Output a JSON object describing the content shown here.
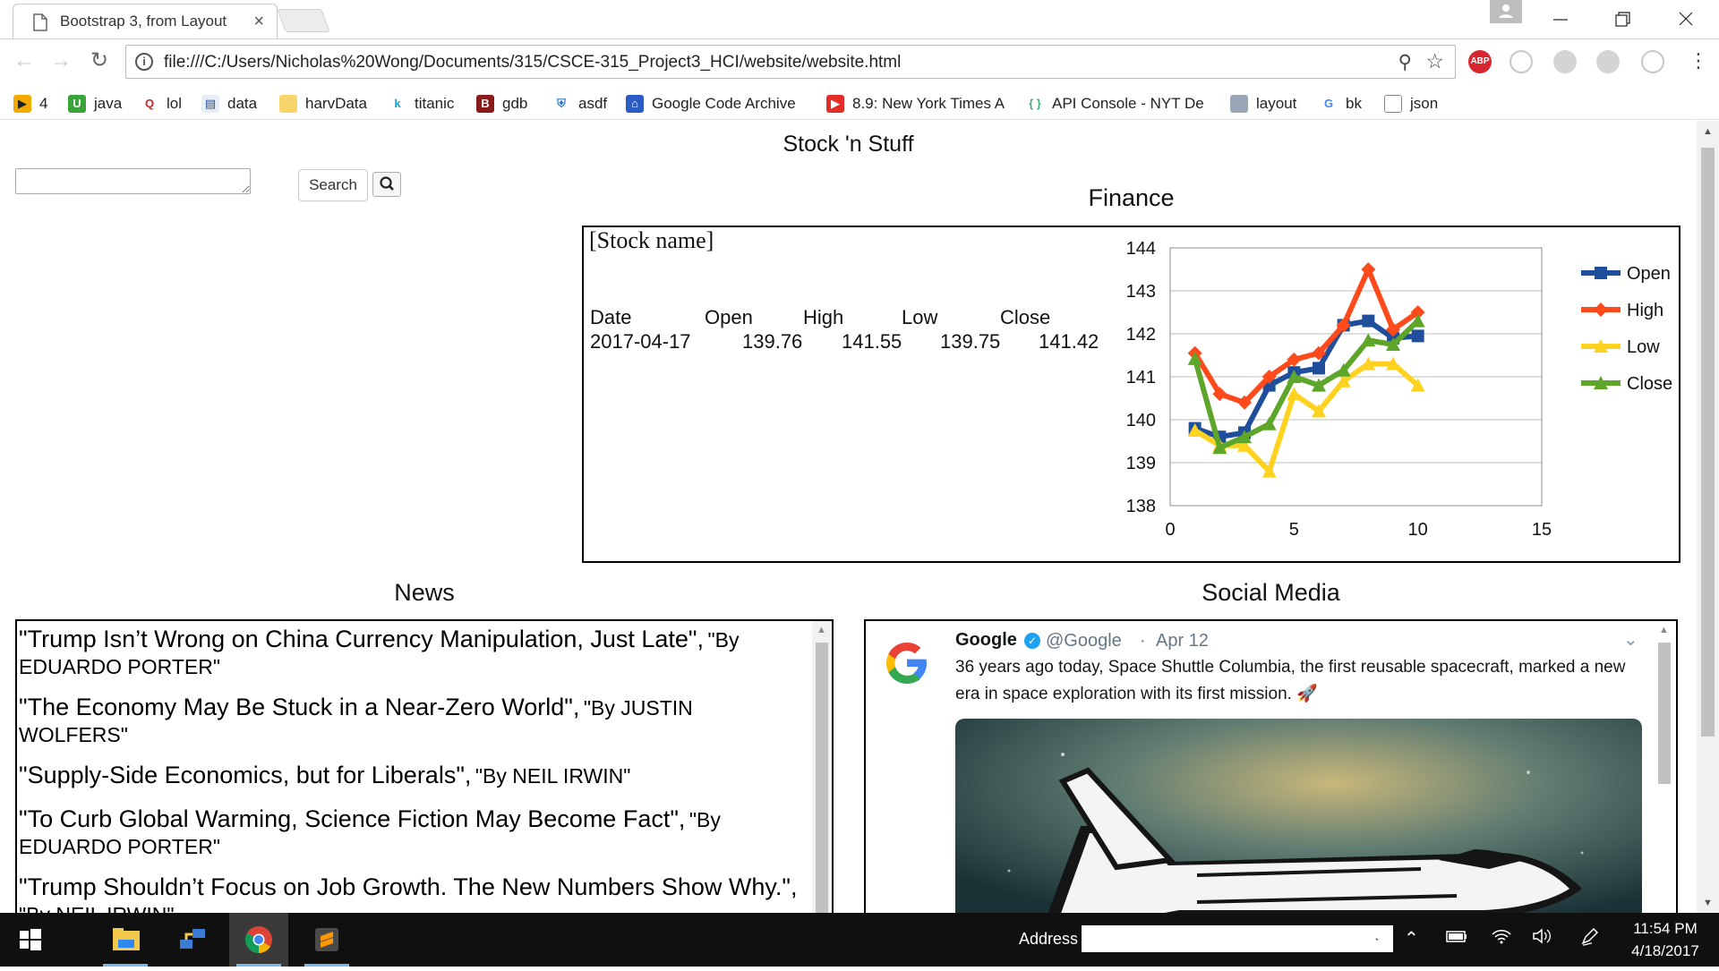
{
  "browser": {
    "tab_title": "Bootstrap 3, from Layout",
    "tab_close": "×",
    "url": "file:///C:/Users/Nicholas%20Wong/Documents/315/CSCE-315_Project3_HCI/website/website.html",
    "extensions": [
      "ABP"
    ],
    "bookmarks": [
      {
        "label": "4",
        "icon": "play-icon"
      },
      {
        "label": "java",
        "icon": "u-icon"
      },
      {
        "label": "lol",
        "icon": "q-icon"
      },
      {
        "label": "data",
        "icon": "data-icon"
      },
      {
        "label": "harvData",
        "icon": "folder-icon"
      },
      {
        "label": "titanic",
        "icon": "k-icon"
      },
      {
        "label": "gdb",
        "icon": "be-icon"
      },
      {
        "label": "asdf",
        "icon": "shield-icon"
      },
      {
        "label": "Google Code Archive",
        "icon": "api-icon"
      },
      {
        "label": "8.9: New York Times A",
        "icon": "youtube-icon"
      },
      {
        "label": "API Console - NYT De",
        "icon": "braces-icon"
      },
      {
        "label": "layout",
        "icon": "box-icon"
      },
      {
        "label": "bk",
        "icon": "google-icon"
      },
      {
        "label": "json",
        "icon": "page-icon"
      }
    ]
  },
  "page": {
    "title": "Stock 'n Stuff",
    "search_button": "Search",
    "search_value": ""
  },
  "finance": {
    "heading": "Finance",
    "stock_name": "[Stock name]",
    "columns": [
      "Date",
      "Open",
      "High",
      "Low",
      "Close"
    ],
    "row": [
      "2017-04-17",
      "139.76",
      "141.55",
      "139.75",
      "141.42"
    ]
  },
  "chart_data": {
    "type": "line",
    "title": "",
    "xlabel": "",
    "ylabel": "",
    "xlim": [
      0,
      15
    ],
    "ylim": [
      138,
      144
    ],
    "x_ticks": [
      0,
      5,
      10,
      15
    ],
    "y_ticks": [
      138,
      139,
      140,
      141,
      142,
      143,
      144
    ],
    "grid": "horizontal",
    "legend_position": "right",
    "x": [
      1,
      2,
      3,
      4,
      5,
      6,
      7,
      8,
      9,
      10
    ],
    "series": [
      {
        "name": "Open",
        "color": "#1f4e9c",
        "marker": "square",
        "values": [
          139.8,
          139.6,
          139.7,
          140.8,
          141.1,
          141.2,
          142.2,
          142.3,
          141.9,
          141.95
        ]
      },
      {
        "name": "High",
        "color": "#ff4a1c",
        "marker": "diamond",
        "values": [
          141.55,
          140.6,
          140.4,
          141.0,
          141.4,
          141.55,
          142.2,
          143.5,
          142.1,
          142.5
        ]
      },
      {
        "name": "Low",
        "color": "#ffd21f",
        "marker": "triangle",
        "values": [
          139.75,
          139.4,
          139.4,
          138.8,
          140.6,
          140.2,
          140.9,
          141.3,
          141.3,
          140.8
        ]
      },
      {
        "name": "Close",
        "color": "#5ea62a",
        "marker": "triangle",
        "values": [
          141.42,
          139.35,
          139.6,
          139.9,
          141.0,
          140.8,
          141.15,
          141.85,
          141.75,
          142.3
        ]
      }
    ]
  },
  "news": {
    "heading": "News",
    "items": [
      {
        "headline": "\"Trump Isn’t Wrong on China Currency Manipulation, Just Late\",",
        "byline": "\"By EDUARDO PORTER\""
      },
      {
        "headline": "\"The Economy May Be Stuck in a Near-Zero World\",",
        "byline": "\"By JUSTIN WOLFERS\""
      },
      {
        "headline": "\"Supply-Side Economics, but for Liberals\",",
        "byline": "\"By NEIL IRWIN\""
      },
      {
        "headline": "\"To Curb Global Warming, Science Fiction May Become Fact\",",
        "byline": "\"By EDUARDO PORTER\""
      },
      {
        "headline": "\"Trump Shouldn’t Focus on Job Growth. The New Numbers Show Why.\",",
        "byline": "\"By NEIL IRWIN\""
      }
    ]
  },
  "social": {
    "heading": "Social Media",
    "tweet": {
      "name": "Google",
      "handle": "@Google",
      "separator": "·",
      "date": "Apr 12",
      "text": "36 years ago today, Space Shuttle Columbia, the first reusable spacecraft, marked a new era in space exploration with its first mission. 🚀"
    }
  },
  "taskbar": {
    "address_label": "Address",
    "time": "11:54 PM",
    "date": "4/18/2017"
  }
}
